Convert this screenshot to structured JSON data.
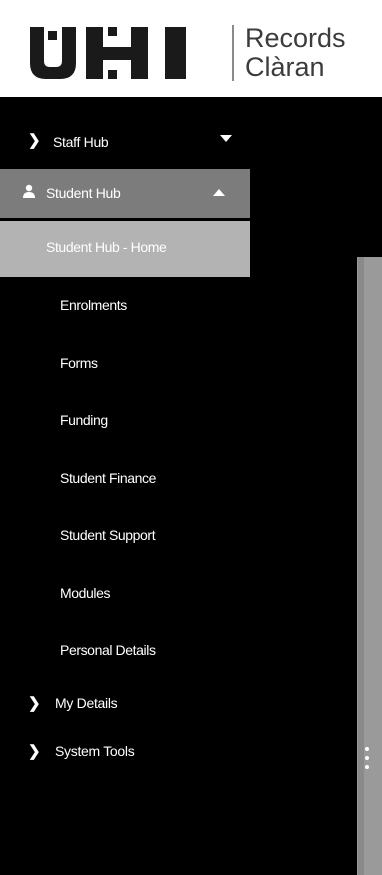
{
  "brand": {
    "mark": "UHI",
    "line1": "Records",
    "line2": "Clàran"
  },
  "sidebar": {
    "staff_hub": {
      "label": "Staff Hub",
      "icon": "chevron-right-icon",
      "toggle_icon": "caret-down-icon"
    },
    "student_hub": {
      "label": "Student Hub",
      "icon": "person-icon",
      "toggle_icon": "caret-up-icon"
    },
    "student_hub_items": [
      {
        "label": "Student Hub - Home",
        "active": true
      },
      {
        "label": "Enrolments"
      },
      {
        "label": "Forms"
      },
      {
        "label": "Funding"
      },
      {
        "label": "Student Finance"
      },
      {
        "label": "Student Support"
      },
      {
        "label": "Modules"
      },
      {
        "label": "Personal Details"
      }
    ],
    "my_details": {
      "label": "My Details",
      "icon": "chevron-right-icon"
    },
    "system_tools": {
      "label": "System Tools",
      "icon": "chevron-right-icon"
    }
  },
  "colors": {
    "sidebar_bg": "#000000",
    "active_group_bg": "#7c7c7c",
    "active_item_bg": "#b3b3b3",
    "text": "#ffffff"
  }
}
